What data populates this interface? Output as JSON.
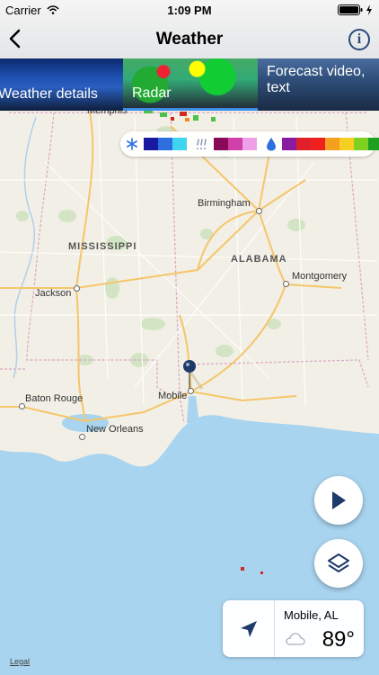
{
  "status_bar": {
    "carrier": "Carrier",
    "time": "1:09 PM"
  },
  "header": {
    "title": "Weather"
  },
  "tabs": [
    {
      "label": "Weather details"
    },
    {
      "label": "Radar"
    },
    {
      "label": "Forecast video, text"
    }
  ],
  "map": {
    "states": [
      "MISSISSIPPI",
      "ALABAMA"
    ],
    "cities": [
      "Memphis",
      "Birmingham",
      "Jackson",
      "Montgomery",
      "Baton Rouge",
      "Mobile",
      "New Orleans"
    ],
    "legal": "Legal"
  },
  "legend": {
    "snow_colors": [
      "#1a1aa0",
      "#2e6fe0",
      "#3fd4f0"
    ],
    "mix_colors": [
      "#8a0a5a",
      "#d040a8",
      "#f0a0e8"
    ],
    "rain_colors": [
      "#8a1aa0",
      "#e0202a",
      "#f02020",
      "#f5a020",
      "#f5d020",
      "#80d020",
      "#20a020"
    ]
  },
  "location_card": {
    "name": "Mobile, AL",
    "temperature": "89°"
  },
  "colors": {
    "accent": "#3a8ee6",
    "water": "#a9d4ef",
    "land": "#f2efe6",
    "highway": "#f5c66a"
  }
}
